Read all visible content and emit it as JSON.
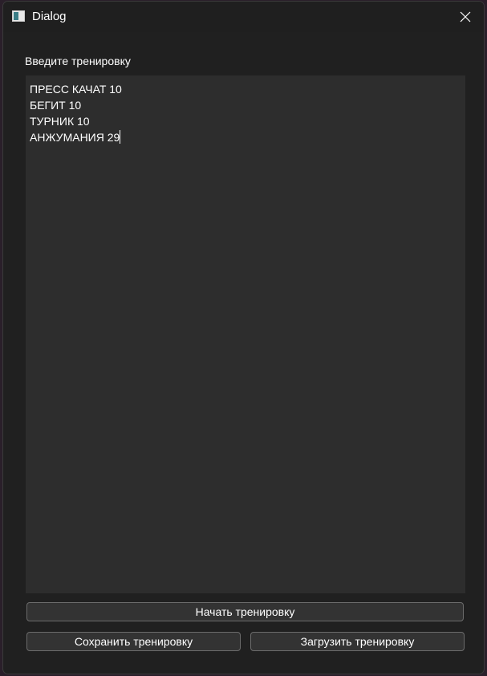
{
  "window": {
    "title": "Dialog",
    "icon": "window-app-icon",
    "close_icon": "close-icon"
  },
  "form": {
    "label": "Введите тренировку",
    "workout_lines": [
      "ПРЕСС КАЧАТ 10",
      "БЕГИТ 10",
      "ТУРНИК 10",
      "АНЖУМАНИЯ 29"
    ]
  },
  "buttons": {
    "start": "Начать тренировку",
    "save": "Сохранить тренировку",
    "load": "Загрузить тренировку"
  }
}
